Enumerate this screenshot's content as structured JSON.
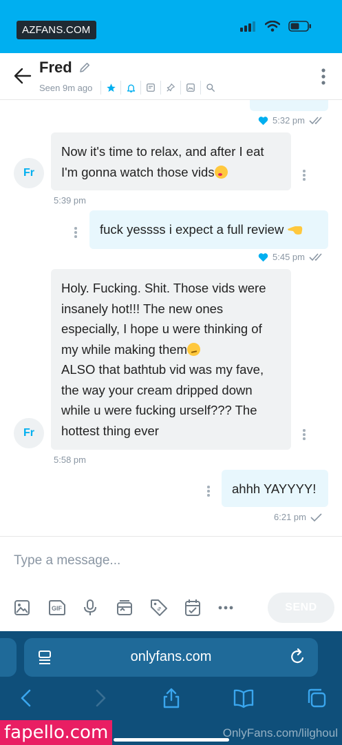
{
  "watermark_top": "AZFANS.COM",
  "header": {
    "name": "Fred",
    "seen": "Seen 9m ago",
    "icons": [
      "star-icon",
      "bell-icon",
      "note-icon",
      "pin-icon",
      "image-icon",
      "search-icon"
    ]
  },
  "messages": [
    {
      "dir": "out",
      "time": "5:32 pm"
    },
    {
      "dir": "in",
      "avatar": "Fr",
      "lines": [
        "Now it's time to relax, and after I eat",
        "I'm gonna watch those vids"
      ],
      "time": "5:39 pm"
    },
    {
      "dir": "out",
      "text": "fuck yessss i expect a full review",
      "time": "5:45 pm"
    },
    {
      "dir": "in",
      "avatar": "Fr",
      "lines": [
        "Holy. Fucking. Shit. Those vids were",
        "insanely hot!!! The new ones",
        "especially, I hope u were thinking of",
        "my while making them",
        "ALSO that bathtub vid was my fave,",
        "the way your cream dripped down",
        "while u were fucking urself??? The",
        "hottest thing ever"
      ],
      "time": "5:58 pm"
    },
    {
      "dir": "out",
      "text": "ahhh YAYYYY!",
      "time": "6:21 pm"
    }
  ],
  "composer": {
    "placeholder": "Type a message...",
    "tools": [
      "image-icon",
      "gif-icon",
      "microphone-icon",
      "media-vault-icon",
      "price-tag-icon",
      "calendar-icon",
      "more-icon"
    ],
    "send_label": "SEND"
  },
  "browser": {
    "url": "onlyfans.com"
  },
  "watermark_bottom": "fapello.com",
  "watermark_of": "OnlyFans.com/lilghoul",
  "colors": {
    "accent": "#00aff0",
    "incoming_bubble": "#f0f2f3",
    "outgoing_bubble": "#e8f7fd",
    "browser_bar": "#0f4f7a"
  }
}
